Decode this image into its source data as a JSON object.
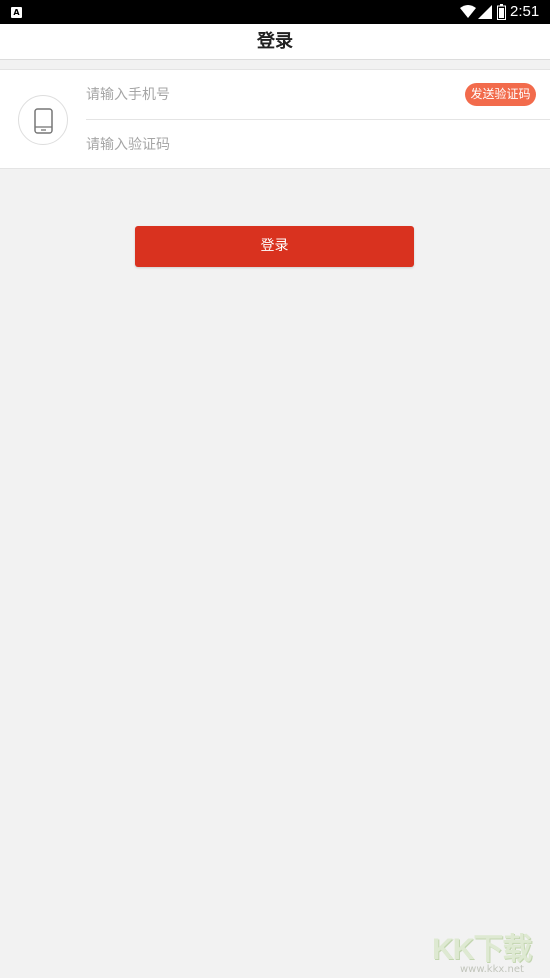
{
  "status_bar": {
    "time": "2:51",
    "notification_icon": "notification-a-icon",
    "icons": [
      "wifi-icon",
      "signal-icon",
      "battery-icon"
    ]
  },
  "header": {
    "title": "登录"
  },
  "form": {
    "phone_placeholder": "请输入手机号",
    "phone_value": "",
    "code_placeholder": "请输入验证码",
    "code_value": "",
    "send_code_label": "发送验证码",
    "avatar_icon": "smartphone-icon"
  },
  "login_button": {
    "label": "登录"
  },
  "colors": {
    "accent": "#d9321f",
    "send_code_bg": "#f26b4c",
    "background": "#f2f2f2"
  },
  "watermark": {
    "url": "www.kkx.net"
  }
}
